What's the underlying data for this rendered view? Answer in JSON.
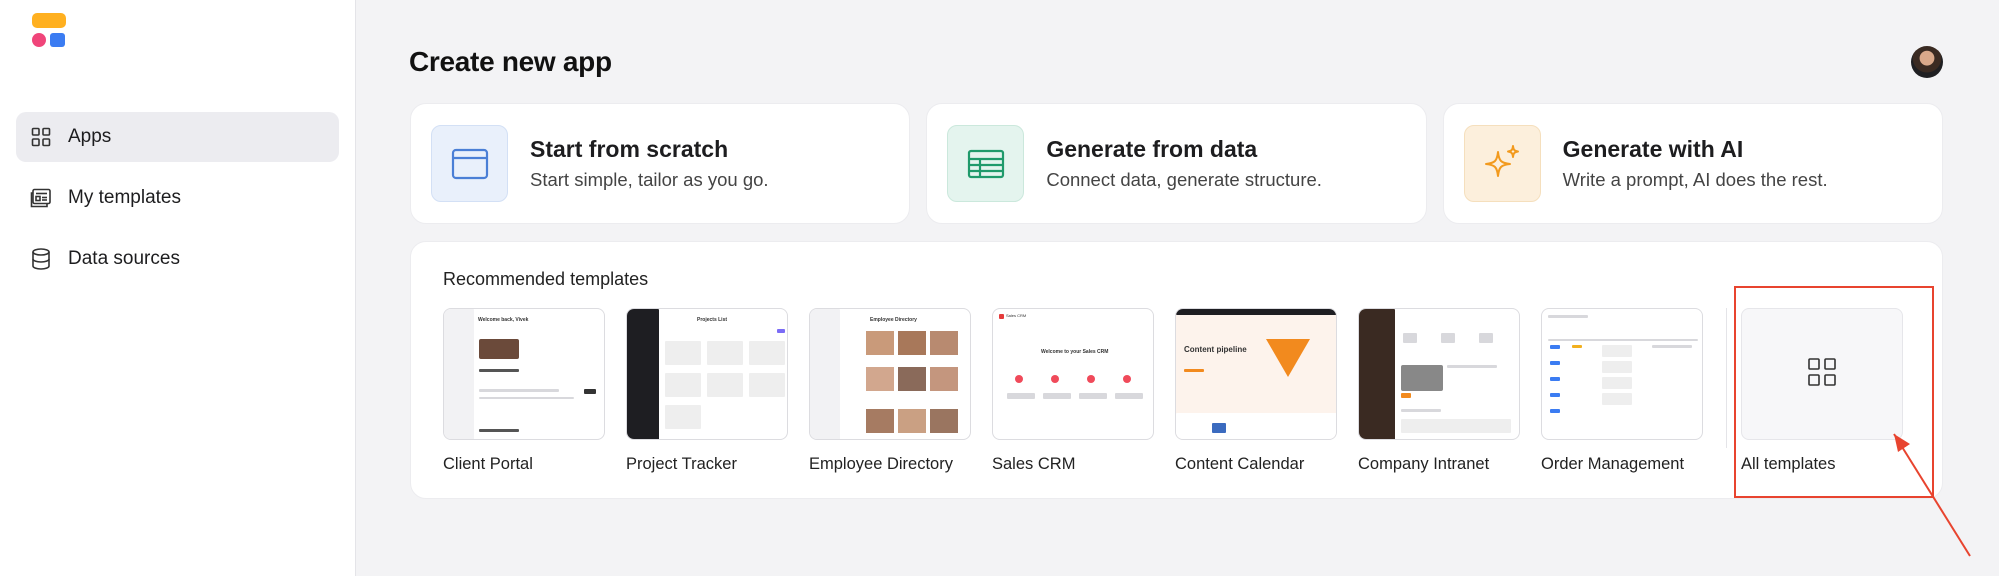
{
  "sidebar": {
    "items": [
      {
        "label": "Apps",
        "icon": "grid-icon",
        "active": true
      },
      {
        "label": "My templates",
        "icon": "templates-icon",
        "active": false
      },
      {
        "label": "Data sources",
        "icon": "database-icon",
        "active": false
      }
    ]
  },
  "header": {
    "title": "Create new app"
  },
  "create_options": [
    {
      "title": "Start from scratch",
      "subtitle": "Start simple, tailor as you go.",
      "icon": "window-icon",
      "tile_color": "#e9f0fb",
      "icon_color": "#4a7fd6"
    },
    {
      "title": "Generate from data",
      "subtitle": "Connect data, generate structure.",
      "icon": "table-icon",
      "tile_color": "#e4f4ee",
      "icon_color": "#1f9a6b"
    },
    {
      "title": "Generate with AI",
      "subtitle": "Write a prompt, AI does the rest.",
      "icon": "sparkle-icon",
      "tile_color": "#fcefdc",
      "icon_color": "#f29a1e"
    }
  ],
  "recommended": {
    "title": "Recommended templates",
    "templates": [
      {
        "name": "Client Portal"
      },
      {
        "name": "Project Tracker"
      },
      {
        "name": "Employee Directory"
      },
      {
        "name": "Sales CRM"
      },
      {
        "name": "Content Calendar"
      },
      {
        "name": "Company Intranet"
      },
      {
        "name": "Order Management"
      }
    ],
    "all_templates_label": "All templates"
  },
  "thumb_text": {
    "client_portal": "Welcome back, Vivek",
    "project_tracker": "Projects List",
    "employee_directory": "Employee Directory",
    "sales_crm_brand": "Sales CRM",
    "sales_crm": "Welcome to your Sales CRM",
    "content_calendar": "Content pipeline"
  },
  "colors": {
    "accent_highlight": "#e8442f",
    "logo_yellow": "#ffb020",
    "logo_pink": "#f0457a",
    "logo_blue": "#3b7cf2"
  }
}
